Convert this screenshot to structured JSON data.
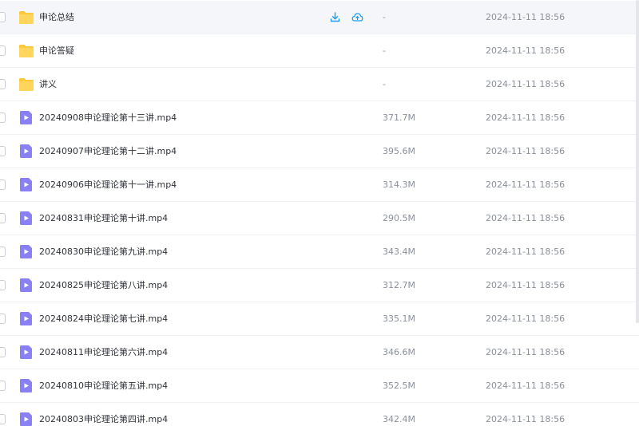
{
  "file_list": {
    "rows": [
      {
        "type": "folder",
        "name": "申论总结",
        "size": "-",
        "modified": "2024-11-11 18:56",
        "hovered": true
      },
      {
        "type": "folder",
        "name": "申论答疑",
        "size": "-",
        "modified": "2024-11-11 18:56"
      },
      {
        "type": "folder",
        "name": "讲义",
        "size": "-",
        "modified": "2024-11-11 18:56"
      },
      {
        "type": "video",
        "name": "20240908申论理论第十三讲.mp4",
        "size": "371.7M",
        "modified": "2024-11-11 18:56"
      },
      {
        "type": "video",
        "name": "20240907申论理论第十二讲.mp4",
        "size": "395.6M",
        "modified": "2024-11-11 18:56"
      },
      {
        "type": "video",
        "name": "20240906申论理论第十一讲.mp4",
        "size": "314.3M",
        "modified": "2024-11-11 18:56"
      },
      {
        "type": "video",
        "name": "20240831申论理论第十讲.mp4",
        "size": "290.5M",
        "modified": "2024-11-11 18:56"
      },
      {
        "type": "video",
        "name": "20240830申论理论第九讲.mp4",
        "size": "343.4M",
        "modified": "2024-11-11 18:56"
      },
      {
        "type": "video",
        "name": "20240825申论理论第八讲.mp4",
        "size": "312.7M",
        "modified": "2024-11-11 18:56"
      },
      {
        "type": "video",
        "name": "20240824申论理论第七讲.mp4",
        "size": "335.1M",
        "modified": "2024-11-11 18:56"
      },
      {
        "type": "video",
        "name": "20240811申论理论第六讲.mp4",
        "size": "346.6M",
        "modified": "2024-11-11 18:56"
      },
      {
        "type": "video",
        "name": "20240810申论理论第五讲.mp4",
        "size": "352.5M",
        "modified": "2024-11-11 18:56"
      },
      {
        "type": "video",
        "name": "20240803申论理论第四讲.mp4",
        "size": "342.4M",
        "modified": "2024-11-11 18:56"
      }
    ],
    "hover_actions": [
      "download-icon",
      "cloud-upload-icon"
    ]
  },
  "colors": {
    "folder": "#fcc83c",
    "video": "#8a80f5",
    "action": "#1e9ef0"
  }
}
